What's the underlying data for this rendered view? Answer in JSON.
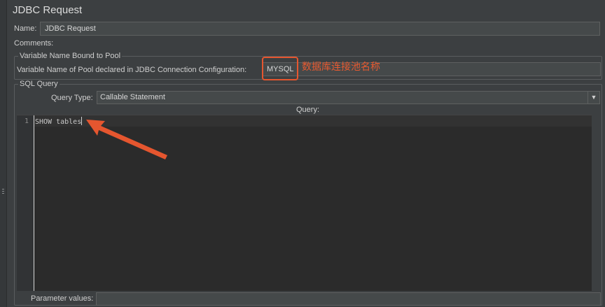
{
  "panel": {
    "title": "JDBC Request",
    "name_label": "Name:",
    "name_value": "JDBC Request",
    "comments_label": "Comments:"
  },
  "pool": {
    "group_title": "Variable Name Bound to Pool",
    "label": "Variable Name of Pool declared in JDBC Connection Configuration:",
    "value": "MYSQL"
  },
  "sql": {
    "group_title": "SQL Query",
    "query_type_label": "Query Type:",
    "query_type_value": "Callable Statement",
    "query_label": "Query:",
    "line_number": "1",
    "query_text": "SHOW tables"
  },
  "params": {
    "label": "Parameter values:"
  },
  "annotation": {
    "text": "数据库连接池名称",
    "color": "#e5562f"
  }
}
